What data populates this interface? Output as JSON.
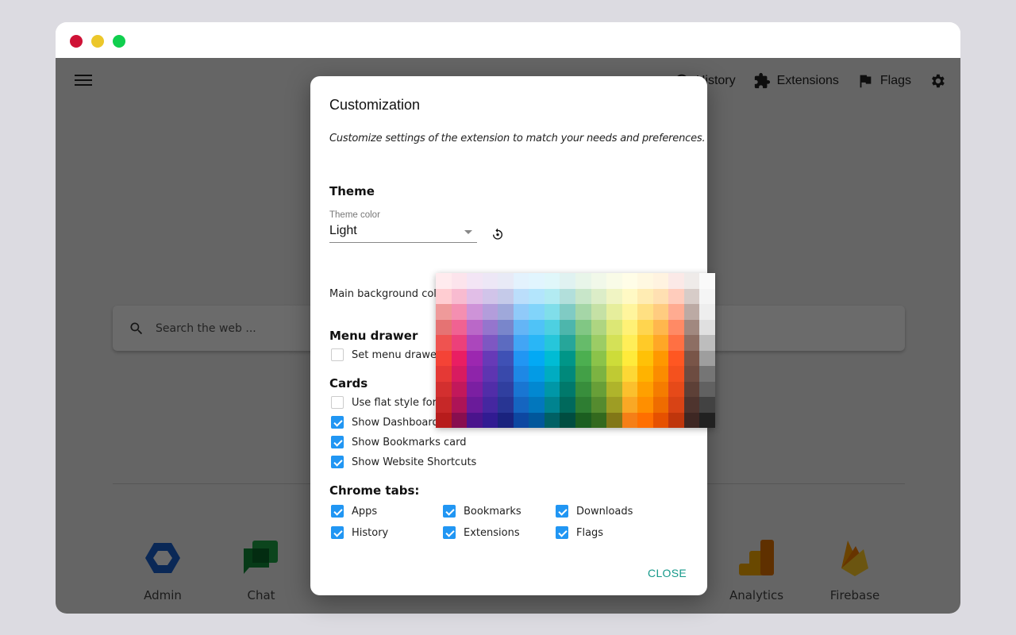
{
  "window": {
    "traffic_lights": [
      "close",
      "minimize",
      "maximize"
    ]
  },
  "topnav": {
    "menu_icon": "hamburger-menu-icon",
    "items": [
      {
        "label": "History",
        "icon": "history-icon"
      },
      {
        "label": "Extensions",
        "icon": "puzzle-icon"
      },
      {
        "label": "Flags",
        "icon": "flag-icon"
      }
    ],
    "settings_icon": "gear-icon"
  },
  "search": {
    "placeholder": "Search the web ..."
  },
  "shortcuts": [
    {
      "label": "Admin",
      "icon": "admin-icon"
    },
    {
      "label": "Chat",
      "icon": "chat-icon"
    },
    {
      "label": "Analytics",
      "icon": "analytics-icon"
    },
    {
      "label": "Firebase",
      "icon": "firebase-icon"
    }
  ],
  "dialog": {
    "title": "Customization",
    "subtitle": "Customize settings of the extension to match your needs and preferences.",
    "theme": {
      "heading": "Theme",
      "field_label": "Theme color",
      "selected": "Light",
      "main_bg_label": "Main background color"
    },
    "menu_drawer": {
      "heading": "Menu drawer",
      "options": [
        {
          "label": "Set menu drawer t",
          "checked": false
        }
      ]
    },
    "cards": {
      "heading": "Cards",
      "options": [
        {
          "label": "Use flat style for D",
          "checked": false
        },
        {
          "label": "Show Dashboard c",
          "checked": true
        },
        {
          "label": "Show Bookmarks card",
          "checked": true
        },
        {
          "label": "Show Website Shortcuts",
          "checked": true
        }
      ]
    },
    "chrome_tabs": {
      "heading": "Chrome tabs:",
      "options": [
        {
          "label": "Apps",
          "checked": true
        },
        {
          "label": "Bookmarks",
          "checked": true
        },
        {
          "label": "Downloads",
          "checked": true
        },
        {
          "label": "History",
          "checked": true
        },
        {
          "label": "Extensions",
          "checked": true
        },
        {
          "label": "Flags",
          "checked": true
        }
      ]
    },
    "close_label": "CLOSE"
  },
  "palette": {
    "columns": [
      [
        "#ffebee",
        "#ffcdd2",
        "#ef9a9a",
        "#e57373",
        "#ef5350",
        "#f44336",
        "#e53935",
        "#d32f2f",
        "#c62828",
        "#b71c1c"
      ],
      [
        "#fce4ec",
        "#f8bbd0",
        "#f48fb1",
        "#f06292",
        "#ec407a",
        "#e91e63",
        "#d81b60",
        "#c2185b",
        "#ad1457",
        "#880e4f"
      ],
      [
        "#f3e5f5",
        "#e1bee7",
        "#ce93d8",
        "#ba68c8",
        "#ab47bc",
        "#9c27b0",
        "#8e24aa",
        "#7b1fa2",
        "#6a1b9a",
        "#4a148c"
      ],
      [
        "#ede7f6",
        "#d1c4e9",
        "#b39ddb",
        "#9575cd",
        "#7e57c2",
        "#673ab7",
        "#5e35b1",
        "#512da8",
        "#4527a0",
        "#311b92"
      ],
      [
        "#e8eaf6",
        "#c5cae9",
        "#9fa8da",
        "#7986cb",
        "#5c6bc0",
        "#3f51b5",
        "#3949ab",
        "#303f9f",
        "#283593",
        "#1a237e"
      ],
      [
        "#e3f2fd",
        "#bbdefb",
        "#90caf9",
        "#64b5f6",
        "#42a5f5",
        "#2196f3",
        "#1e88e5",
        "#1976d2",
        "#1565c0",
        "#0d47a1"
      ],
      [
        "#e1f5fe",
        "#b3e5fc",
        "#81d4fa",
        "#4fc3f7",
        "#29b6f6",
        "#03a9f4",
        "#039be5",
        "#0288d1",
        "#0277bd",
        "#01579b"
      ],
      [
        "#e0f7fa",
        "#b2ebf2",
        "#80deea",
        "#4dd0e1",
        "#26c6da",
        "#00bcd4",
        "#00acc1",
        "#0097a7",
        "#00838f",
        "#006064"
      ],
      [
        "#e0f2f1",
        "#b2dfdb",
        "#80cbc4",
        "#4db6ac",
        "#26a69a",
        "#009688",
        "#00897b",
        "#00796b",
        "#00695c",
        "#004d40"
      ],
      [
        "#e8f5e9",
        "#c8e6c9",
        "#a5d6a7",
        "#81c784",
        "#66bb6a",
        "#4caf50",
        "#43a047",
        "#388e3c",
        "#2e7d32",
        "#1b5e20"
      ],
      [
        "#f1f8e9",
        "#dcedc8",
        "#c5e1a5",
        "#aed581",
        "#9ccc65",
        "#8bc34a",
        "#7cb342",
        "#689f38",
        "#558b2f",
        "#33691e"
      ],
      [
        "#f9fbe7",
        "#f0f4c3",
        "#e6ee9c",
        "#dce775",
        "#d4e157",
        "#cddc39",
        "#c0ca33",
        "#afb42b",
        "#9e9d24",
        "#827717"
      ],
      [
        "#fffde7",
        "#fff9c4",
        "#fff59d",
        "#fff176",
        "#ffee58",
        "#ffeb3b",
        "#fdd835",
        "#fbc02d",
        "#f9a825",
        "#f57f17"
      ],
      [
        "#fff8e1",
        "#ffecb3",
        "#ffe082",
        "#ffd54f",
        "#ffca28",
        "#ffc107",
        "#ffb300",
        "#ffa000",
        "#ff8f00",
        "#ff6f00"
      ],
      [
        "#fff3e0",
        "#ffe0b2",
        "#ffcc80",
        "#ffb74d",
        "#ffa726",
        "#ff9800",
        "#fb8c00",
        "#f57c00",
        "#ef6c00",
        "#e65100"
      ],
      [
        "#fbe9e7",
        "#ffccbc",
        "#ffab91",
        "#ff8a65",
        "#ff7043",
        "#ff5722",
        "#f4511e",
        "#e64a19",
        "#d84315",
        "#bf360c"
      ],
      [
        "#efebe9",
        "#d7ccc8",
        "#bcaaa4",
        "#a1887f",
        "#8d6e63",
        "#795548",
        "#6d4c41",
        "#5d4037",
        "#4e342e",
        "#3e2723"
      ],
      [
        "#fafafa",
        "#f5f5f5",
        "#eeeeee",
        "#e0e0e0",
        "#bdbdbd",
        "#9e9e9e",
        "#757575",
        "#616161",
        "#424242",
        "#212121"
      ]
    ]
  },
  "colors": {
    "accent_checkbox": "#2196f3",
    "close_button": "#15998a"
  }
}
